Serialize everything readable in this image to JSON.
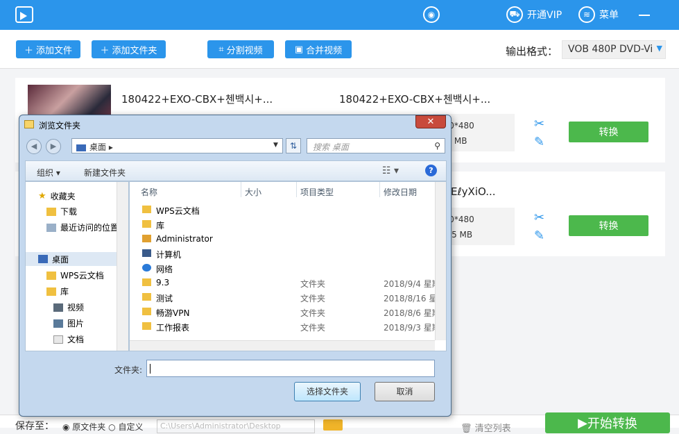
{
  "titlebar": {
    "user_label": "",
    "vip_label": "开通VIP",
    "menu_label": "菜单"
  },
  "toolbar": {
    "add_file": "添加文件",
    "add_folder": "添加文件夹",
    "split_video": "分割视频",
    "merge_video": "合并视频",
    "output_format_label": "输出格式：",
    "output_format_value": "VOB  480P DVD-Vi"
  },
  "files": [
    {
      "source_name": "180422+EXO-CBX+첸백시+...",
      "target_name": "180422+EXO-CBX+첸백시+...",
      "resolution": "720*480",
      "size": ".59 MB",
      "convert_label": "转换"
    },
    {
      "target_name": "EℓyXiO...",
      "resolution": "720*480",
      "size": "2.15 MB",
      "convert_label": "转换"
    }
  ],
  "dialog": {
    "title": "浏览文件夹",
    "address": "桌面",
    "search_placeholder": "搜索 桌面",
    "organize": "组织 ▾",
    "new_folder": "新建文件夹",
    "nav": {
      "favorites": "收藏夹",
      "downloads": "下载",
      "recent": "最近访问的位置",
      "desktop": "桌面",
      "wps_cloud": "WPS云文档",
      "library": "库",
      "videos": "视频",
      "pictures": "图片",
      "documents": "文档"
    },
    "columns": {
      "name": "名称",
      "size": "大小",
      "type": "项目类型",
      "modified": "修改日期"
    },
    "items": [
      {
        "name": "WPS云文档",
        "type": "",
        "date": ""
      },
      {
        "name": "库",
        "type": "",
        "date": ""
      },
      {
        "name": "Administrator",
        "type": "",
        "date": ""
      },
      {
        "name": "计算机",
        "type": "",
        "date": ""
      },
      {
        "name": "网络",
        "type": "",
        "date": ""
      },
      {
        "name": "9.3",
        "type": "文件夹",
        "date": "2018/9/4 星期"
      },
      {
        "name": "测试",
        "type": "文件夹",
        "date": "2018/8/16 星"
      },
      {
        "name": "畅游VPN",
        "type": "文件夹",
        "date": "2018/8/6 星期"
      },
      {
        "name": "工作报表",
        "type": "文件夹",
        "date": "2018/9/3 星期"
      }
    ],
    "folder_label": "文件夹:",
    "folder_value": "",
    "select_button": "选择文件夹",
    "cancel_button": "取消"
  },
  "bottom": {
    "save_label": "保存至：",
    "radio_source": "原文件夹",
    "radio_custom": "自定义",
    "save_path_placeholder": "C:\\Users\\Administrator\\Desktop",
    "clear_list": "清空列表",
    "start_convert": "开始转换"
  },
  "colors": {
    "primary": "#2b95eb",
    "convert_green": "#4cb84c"
  }
}
